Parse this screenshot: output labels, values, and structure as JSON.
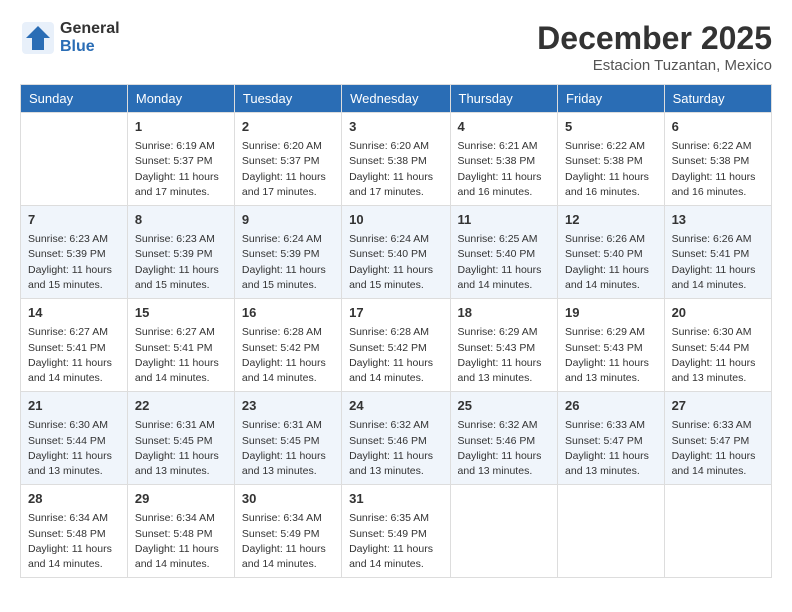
{
  "header": {
    "logo_general": "General",
    "logo_blue": "Blue",
    "month_title": "December 2025",
    "subtitle": "Estacion Tuzantan, Mexico"
  },
  "weekdays": [
    "Sunday",
    "Monday",
    "Tuesday",
    "Wednesday",
    "Thursday",
    "Friday",
    "Saturday"
  ],
  "weeks": [
    [
      {
        "day": "",
        "sunrise": "",
        "sunset": "",
        "daylight": ""
      },
      {
        "day": "1",
        "sunrise": "Sunrise: 6:19 AM",
        "sunset": "Sunset: 5:37 PM",
        "daylight": "Daylight: 11 hours and 17 minutes."
      },
      {
        "day": "2",
        "sunrise": "Sunrise: 6:20 AM",
        "sunset": "Sunset: 5:37 PM",
        "daylight": "Daylight: 11 hours and 17 minutes."
      },
      {
        "day": "3",
        "sunrise": "Sunrise: 6:20 AM",
        "sunset": "Sunset: 5:38 PM",
        "daylight": "Daylight: 11 hours and 17 minutes."
      },
      {
        "day": "4",
        "sunrise": "Sunrise: 6:21 AM",
        "sunset": "Sunset: 5:38 PM",
        "daylight": "Daylight: 11 hours and 16 minutes."
      },
      {
        "day": "5",
        "sunrise": "Sunrise: 6:22 AM",
        "sunset": "Sunset: 5:38 PM",
        "daylight": "Daylight: 11 hours and 16 minutes."
      },
      {
        "day": "6",
        "sunrise": "Sunrise: 6:22 AM",
        "sunset": "Sunset: 5:38 PM",
        "daylight": "Daylight: 11 hours and 16 minutes."
      }
    ],
    [
      {
        "day": "7",
        "sunrise": "Sunrise: 6:23 AM",
        "sunset": "Sunset: 5:39 PM",
        "daylight": "Daylight: 11 hours and 15 minutes."
      },
      {
        "day": "8",
        "sunrise": "Sunrise: 6:23 AM",
        "sunset": "Sunset: 5:39 PM",
        "daylight": "Daylight: 11 hours and 15 minutes."
      },
      {
        "day": "9",
        "sunrise": "Sunrise: 6:24 AM",
        "sunset": "Sunset: 5:39 PM",
        "daylight": "Daylight: 11 hours and 15 minutes."
      },
      {
        "day": "10",
        "sunrise": "Sunrise: 6:24 AM",
        "sunset": "Sunset: 5:40 PM",
        "daylight": "Daylight: 11 hours and 15 minutes."
      },
      {
        "day": "11",
        "sunrise": "Sunrise: 6:25 AM",
        "sunset": "Sunset: 5:40 PM",
        "daylight": "Daylight: 11 hours and 14 minutes."
      },
      {
        "day": "12",
        "sunrise": "Sunrise: 6:26 AM",
        "sunset": "Sunset: 5:40 PM",
        "daylight": "Daylight: 11 hours and 14 minutes."
      },
      {
        "day": "13",
        "sunrise": "Sunrise: 6:26 AM",
        "sunset": "Sunset: 5:41 PM",
        "daylight": "Daylight: 11 hours and 14 minutes."
      }
    ],
    [
      {
        "day": "14",
        "sunrise": "Sunrise: 6:27 AM",
        "sunset": "Sunset: 5:41 PM",
        "daylight": "Daylight: 11 hours and 14 minutes."
      },
      {
        "day": "15",
        "sunrise": "Sunrise: 6:27 AM",
        "sunset": "Sunset: 5:41 PM",
        "daylight": "Daylight: 11 hours and 14 minutes."
      },
      {
        "day": "16",
        "sunrise": "Sunrise: 6:28 AM",
        "sunset": "Sunset: 5:42 PM",
        "daylight": "Daylight: 11 hours and 14 minutes."
      },
      {
        "day": "17",
        "sunrise": "Sunrise: 6:28 AM",
        "sunset": "Sunset: 5:42 PM",
        "daylight": "Daylight: 11 hours and 14 minutes."
      },
      {
        "day": "18",
        "sunrise": "Sunrise: 6:29 AM",
        "sunset": "Sunset: 5:43 PM",
        "daylight": "Daylight: 11 hours and 13 minutes."
      },
      {
        "day": "19",
        "sunrise": "Sunrise: 6:29 AM",
        "sunset": "Sunset: 5:43 PM",
        "daylight": "Daylight: 11 hours and 13 minutes."
      },
      {
        "day": "20",
        "sunrise": "Sunrise: 6:30 AM",
        "sunset": "Sunset: 5:44 PM",
        "daylight": "Daylight: 11 hours and 13 minutes."
      }
    ],
    [
      {
        "day": "21",
        "sunrise": "Sunrise: 6:30 AM",
        "sunset": "Sunset: 5:44 PM",
        "daylight": "Daylight: 11 hours and 13 minutes."
      },
      {
        "day": "22",
        "sunrise": "Sunrise: 6:31 AM",
        "sunset": "Sunset: 5:45 PM",
        "daylight": "Daylight: 11 hours and 13 minutes."
      },
      {
        "day": "23",
        "sunrise": "Sunrise: 6:31 AM",
        "sunset": "Sunset: 5:45 PM",
        "daylight": "Daylight: 11 hours and 13 minutes."
      },
      {
        "day": "24",
        "sunrise": "Sunrise: 6:32 AM",
        "sunset": "Sunset: 5:46 PM",
        "daylight": "Daylight: 11 hours and 13 minutes."
      },
      {
        "day": "25",
        "sunrise": "Sunrise: 6:32 AM",
        "sunset": "Sunset: 5:46 PM",
        "daylight": "Daylight: 11 hours and 13 minutes."
      },
      {
        "day": "26",
        "sunrise": "Sunrise: 6:33 AM",
        "sunset": "Sunset: 5:47 PM",
        "daylight": "Daylight: 11 hours and 13 minutes."
      },
      {
        "day": "27",
        "sunrise": "Sunrise: 6:33 AM",
        "sunset": "Sunset: 5:47 PM",
        "daylight": "Daylight: 11 hours and 14 minutes."
      }
    ],
    [
      {
        "day": "28",
        "sunrise": "Sunrise: 6:34 AM",
        "sunset": "Sunset: 5:48 PM",
        "daylight": "Daylight: 11 hours and 14 minutes."
      },
      {
        "day": "29",
        "sunrise": "Sunrise: 6:34 AM",
        "sunset": "Sunset: 5:48 PM",
        "daylight": "Daylight: 11 hours and 14 minutes."
      },
      {
        "day": "30",
        "sunrise": "Sunrise: 6:34 AM",
        "sunset": "Sunset: 5:49 PM",
        "daylight": "Daylight: 11 hours and 14 minutes."
      },
      {
        "day": "31",
        "sunrise": "Sunrise: 6:35 AM",
        "sunset": "Sunset: 5:49 PM",
        "daylight": "Daylight: 11 hours and 14 minutes."
      },
      {
        "day": "",
        "sunrise": "",
        "sunset": "",
        "daylight": ""
      },
      {
        "day": "",
        "sunrise": "",
        "sunset": "",
        "daylight": ""
      },
      {
        "day": "",
        "sunrise": "",
        "sunset": "",
        "daylight": ""
      }
    ]
  ]
}
